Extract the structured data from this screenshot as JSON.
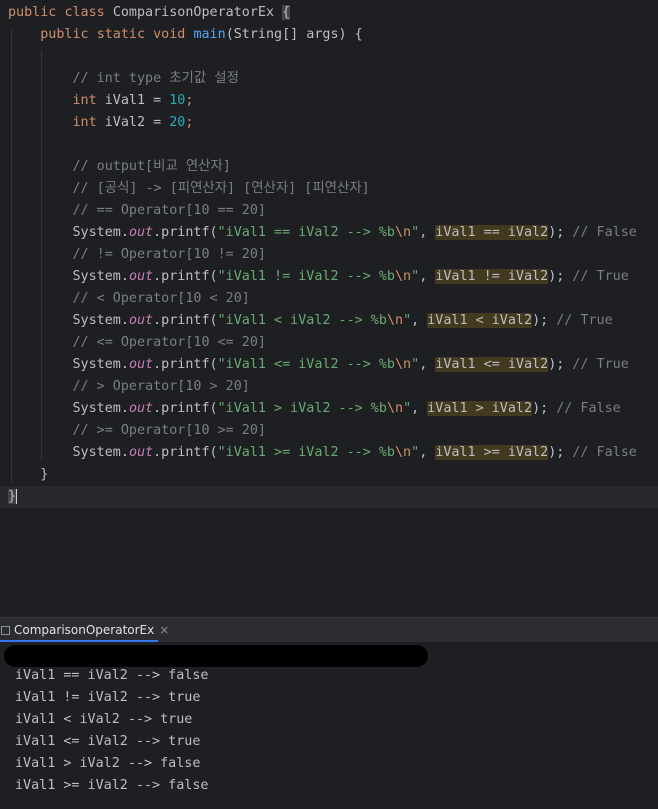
{
  "editor": {
    "lines": [
      [
        {
          "t": "public",
          "c": "kw"
        },
        {
          "t": " ",
          "c": "ws"
        },
        {
          "t": "class",
          "c": "kw"
        },
        {
          "t": " ",
          "c": "ws"
        },
        {
          "t": "ComparisonOperatorEx",
          "c": "ident"
        },
        {
          "t": " ",
          "c": "ws"
        },
        {
          "t": "{",
          "c": "brace-hl"
        }
      ],
      [
        {
          "t": "    ",
          "c": "ws"
        },
        {
          "t": "public",
          "c": "kw"
        },
        {
          "t": " ",
          "c": "ws"
        },
        {
          "t": "static",
          "c": "kw"
        },
        {
          "t": " ",
          "c": "ws"
        },
        {
          "t": "void",
          "c": "kw"
        },
        {
          "t": " ",
          "c": "ws"
        },
        {
          "t": "main",
          "c": "fn"
        },
        {
          "t": "(String[] args) {",
          "c": "ident"
        }
      ],
      [],
      [
        {
          "t": "        ",
          "c": "ws"
        },
        {
          "t": "// int type 초기값 설정",
          "c": "cmt"
        }
      ],
      [
        {
          "t": "        ",
          "c": "ws"
        },
        {
          "t": "int",
          "c": "kw"
        },
        {
          "t": " ",
          "c": "ws"
        },
        {
          "t": "iVal1 = ",
          "c": "ident"
        },
        {
          "t": "10",
          "c": "num"
        },
        {
          "t": ";",
          "c": "kw"
        }
      ],
      [
        {
          "t": "        ",
          "c": "ws"
        },
        {
          "t": "int",
          "c": "kw"
        },
        {
          "t": " ",
          "c": "ws"
        },
        {
          "t": "iVal2 = ",
          "c": "ident"
        },
        {
          "t": "20",
          "c": "num"
        },
        {
          "t": ";",
          "c": "kw"
        }
      ],
      [],
      [
        {
          "t": "        ",
          "c": "ws"
        },
        {
          "t": "// output[비교 연산자]",
          "c": "cmt"
        }
      ],
      [
        {
          "t": "        ",
          "c": "ws"
        },
        {
          "t": "// [공식] -> [피연산자] [연산자] [피연산자]",
          "c": "cmt"
        }
      ],
      [
        {
          "t": "        ",
          "c": "ws"
        },
        {
          "t": "// == Operator[10 == 20]",
          "c": "cmt"
        }
      ],
      [
        {
          "t": "        ",
          "c": "ws"
        },
        {
          "t": "System.",
          "c": "ident"
        },
        {
          "t": "out",
          "c": "fld"
        },
        {
          "t": ".printf(",
          "c": "ident"
        },
        {
          "t": "\"iVal1 == iVal2 --> %b",
          "c": "str"
        },
        {
          "t": "\\n",
          "c": "esc"
        },
        {
          "t": "\"",
          "c": "str"
        },
        {
          "t": ", ",
          "c": "ident"
        },
        {
          "t": "iVal1 == iVal2",
          "c": "hl"
        },
        {
          "t": ");",
          "c": "ident"
        },
        {
          "t": " ",
          "c": "ws"
        },
        {
          "t": "// False",
          "c": "cmt"
        }
      ],
      [
        {
          "t": "        ",
          "c": "ws"
        },
        {
          "t": "// != Operator[10 != 20]",
          "c": "cmt"
        }
      ],
      [
        {
          "t": "        ",
          "c": "ws"
        },
        {
          "t": "System.",
          "c": "ident"
        },
        {
          "t": "out",
          "c": "fld"
        },
        {
          "t": ".printf(",
          "c": "ident"
        },
        {
          "t": "\"iVal1 != iVal2 --> %b",
          "c": "str"
        },
        {
          "t": "\\n",
          "c": "esc"
        },
        {
          "t": "\"",
          "c": "str"
        },
        {
          "t": ", ",
          "c": "ident"
        },
        {
          "t": "iVal1 != iVal2",
          "c": "hl"
        },
        {
          "t": ");",
          "c": "ident"
        },
        {
          "t": " ",
          "c": "ws"
        },
        {
          "t": "// True",
          "c": "cmt"
        }
      ],
      [
        {
          "t": "        ",
          "c": "ws"
        },
        {
          "t": "// < Operator[10 < 20]",
          "c": "cmt"
        }
      ],
      [
        {
          "t": "        ",
          "c": "ws"
        },
        {
          "t": "System.",
          "c": "ident"
        },
        {
          "t": "out",
          "c": "fld"
        },
        {
          "t": ".printf(",
          "c": "ident"
        },
        {
          "t": "\"iVal1 < iVal2 --> %b",
          "c": "str"
        },
        {
          "t": "\\n",
          "c": "esc"
        },
        {
          "t": "\"",
          "c": "str"
        },
        {
          "t": ", ",
          "c": "ident"
        },
        {
          "t": "iVal1 < iVal2",
          "c": "hl"
        },
        {
          "t": ");",
          "c": "ident"
        },
        {
          "t": " ",
          "c": "ws"
        },
        {
          "t": "// True",
          "c": "cmt"
        }
      ],
      [
        {
          "t": "        ",
          "c": "ws"
        },
        {
          "t": "// <= Operator[10 <= 20]",
          "c": "cmt"
        }
      ],
      [
        {
          "t": "        ",
          "c": "ws"
        },
        {
          "t": "System.",
          "c": "ident"
        },
        {
          "t": "out",
          "c": "fld"
        },
        {
          "t": ".printf(",
          "c": "ident"
        },
        {
          "t": "\"iVal1 <= iVal2 --> %b",
          "c": "str"
        },
        {
          "t": "\\n",
          "c": "esc"
        },
        {
          "t": "\"",
          "c": "str"
        },
        {
          "t": ", ",
          "c": "ident"
        },
        {
          "t": "iVal1 <= iVal2",
          "c": "hl"
        },
        {
          "t": ");",
          "c": "ident"
        },
        {
          "t": " ",
          "c": "ws"
        },
        {
          "t": "// True",
          "c": "cmt"
        }
      ],
      [
        {
          "t": "        ",
          "c": "ws"
        },
        {
          "t": "// > Operator[10 > 20]",
          "c": "cmt"
        }
      ],
      [
        {
          "t": "        ",
          "c": "ws"
        },
        {
          "t": "System.",
          "c": "ident"
        },
        {
          "t": "out",
          "c": "fld"
        },
        {
          "t": ".printf(",
          "c": "ident"
        },
        {
          "t": "\"iVal1 > iVal2 --> %b",
          "c": "str"
        },
        {
          "t": "\\n",
          "c": "esc"
        },
        {
          "t": "\"",
          "c": "str"
        },
        {
          "t": ", ",
          "c": "ident"
        },
        {
          "t": "iVal1 > iVal2",
          "c": "hl"
        },
        {
          "t": ");",
          "c": "ident"
        },
        {
          "t": " ",
          "c": "ws"
        },
        {
          "t": "// False",
          "c": "cmt"
        }
      ],
      [
        {
          "t": "        ",
          "c": "ws"
        },
        {
          "t": "// >= Operator[10 >= 20]",
          "c": "cmt"
        }
      ],
      [
        {
          "t": "        ",
          "c": "ws"
        },
        {
          "t": "System.",
          "c": "ident"
        },
        {
          "t": "out",
          "c": "fld"
        },
        {
          "t": ".printf(",
          "c": "ident"
        },
        {
          "t": "\"iVal1 >= iVal2 --> %b",
          "c": "str"
        },
        {
          "t": "\\n",
          "c": "esc"
        },
        {
          "t": "\"",
          "c": "str"
        },
        {
          "t": ", ",
          "c": "ident"
        },
        {
          "t": "iVal1 >= iVal2",
          "c": "hl"
        },
        {
          "t": ");",
          "c": "ident"
        },
        {
          "t": " ",
          "c": "ws"
        },
        {
          "t": "// False",
          "c": "cmt"
        }
      ],
      [
        {
          "t": "    ",
          "c": "ws"
        },
        {
          "t": "}",
          "c": "ident"
        }
      ],
      [
        {
          "t": "}",
          "c": "brace-hl"
        }
      ]
    ],
    "current_line": 22
  },
  "console": {
    "tab_label": "ComparisonOperatorEx",
    "close_glyph": "×",
    "output": [
      "iVal1 == iVal2 --> false",
      "iVal1 != iVal2 --> true",
      "iVal1 < iVal2 --> true",
      "iVal1 <= iVal2 --> true",
      "iVal1 > iVal2 --> false",
      "iVal1 >= iVal2 --> false"
    ]
  }
}
